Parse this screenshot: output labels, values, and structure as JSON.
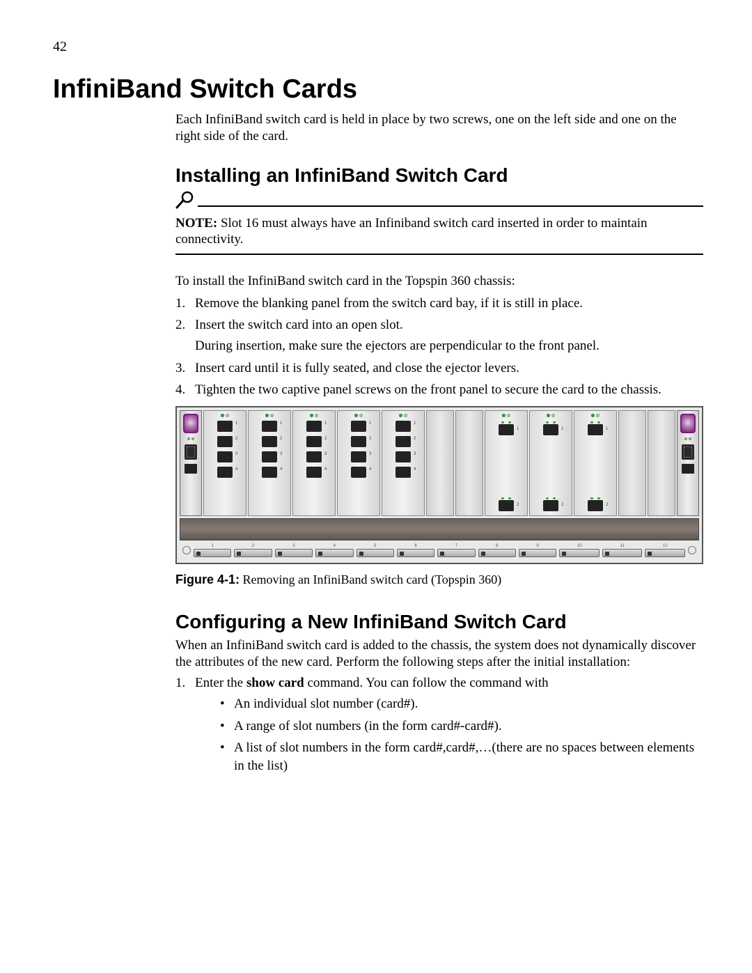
{
  "page_number": "42",
  "h1": "InfiniBand Switch Cards",
  "intro": "Each InfiniBand switch card is held in place by two screws, one on the left side and one on the right side of the card.",
  "section1": {
    "title": "Installing an InfiniBand Switch Card",
    "note_label": "NOTE:",
    "note_text": "Slot 16 must always have an Infiniband switch card inserted in order to maintain connectivity.",
    "lead": "To install the InfiniBand switch card in the Topspin 360 chassis:",
    "steps": [
      {
        "text": "Remove the blanking panel from the switch card bay, if it is still in place."
      },
      {
        "text": "Insert the switch card into an open slot.",
        "sub": "During insertion, make sure the ejectors are perpendicular to the front panel."
      },
      {
        "text": " Insert card until it is fully seated, and close the ejector levers."
      },
      {
        "text": "Tighten the two captive panel screws on the front panel to secure the card to the chassis."
      }
    ],
    "figure": {
      "label": "Figure 4-1:",
      "caption": "Removing an InfiniBand switch card (Topspin 360)",
      "bay_count": 12,
      "slots": [
        {
          "type": "mgmt"
        },
        {
          "type": "quad"
        },
        {
          "type": "quad"
        },
        {
          "type": "quad"
        },
        {
          "type": "quad"
        },
        {
          "type": "quad"
        },
        {
          "type": "empty"
        },
        {
          "type": "empty"
        },
        {
          "type": "dual"
        },
        {
          "type": "dual"
        },
        {
          "type": "dual"
        },
        {
          "type": "empty"
        },
        {
          "type": "empty"
        },
        {
          "type": "mgmt"
        }
      ]
    }
  },
  "section2": {
    "title": "Configuring a New InfiniBand Switch Card",
    "lead": "When an InfiniBand switch card is added to the chassis, the system does not dynamically discover the attributes of the new card. Perform the following steps after the initial installation:",
    "step1_prefix": "Enter the ",
    "step1_bold": "show card",
    "step1_suffix": " command. You can follow the command with",
    "bullets": [
      "An individual slot number (card#).",
      "A range of slot numbers (in the form card#-card#).",
      "A list of slot numbers in the form card#,card#,…(there are no spaces between elements in the list)"
    ]
  }
}
